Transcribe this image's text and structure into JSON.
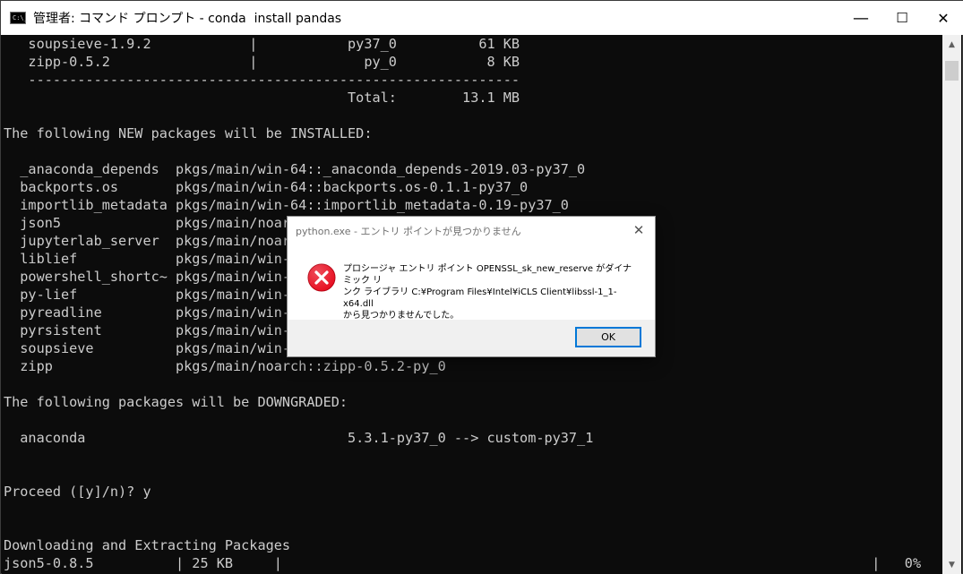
{
  "window": {
    "title": "管理者: コマンド プロンプト - conda  install pandas",
    "icon_text": "C:\\_",
    "minimize": "—",
    "maximize": "☐",
    "close": "✕"
  },
  "console": {
    "lines": [
      "   soupsieve-1.9.2            |           py37_0          61 KB",
      "   zipp-0.5.2                 |             py_0           8 KB",
      "   ------------------------------------------------------------",
      "                                          Total:        13.1 MB",
      "",
      "The following NEW packages will be INSTALLED:",
      "",
      "  _anaconda_depends  pkgs/main/win-64::_anaconda_depends-2019.03-py37_0",
      "  backports.os       pkgs/main/win-64::backports.os-0.1.1-py37_0",
      "  importlib_metadata pkgs/main/win-64::importlib_metadata-0.19-py37_0",
      "  json5              pkgs/main/noarch",
      "  jupyterlab_server  pkgs/main/noarch",
      "  liblief            pkgs/main/win-6",
      "  powershell_shortc~ pkgs/main/win-6",
      "  py-lief            pkgs/main/win-6",
      "  pyreadline         pkgs/main/win-6",
      "  pyrsistent         pkgs/main/win-6",
      "  soupsieve          pkgs/main/win-6",
      "  zipp               pkgs/main/noarch::zipp-0.5.2-py_0",
      "",
      "The following packages will be DOWNGRADED:",
      "",
      "  anaconda                                5.3.1-py37_0 --> custom-py37_1",
      "",
      "",
      "Proceed ([y]/n)? y",
      "",
      "",
      "Downloading and Extracting Packages",
      "json5-0.8.5          | 25 KB     |                                                                        |   0%"
    ]
  },
  "dialog": {
    "title": "python.exe - エントリ ポイントが見つかりません",
    "close": "✕",
    "message_line1": "プロシージャ エントリ ポイント OPENSSL_sk_new_reserve がダイナミック リ",
    "message_line2": "ンク ライブラリ C:¥Program Files¥Intel¥iCLS Client¥libssl-1_1-x64.dll",
    "message_line3": "から見つかりませんでした。",
    "ok_label": "OK",
    "icon": "error-icon",
    "icon_color": "#e81123"
  },
  "scrollbar": {
    "up": "▲",
    "down": "▼"
  }
}
